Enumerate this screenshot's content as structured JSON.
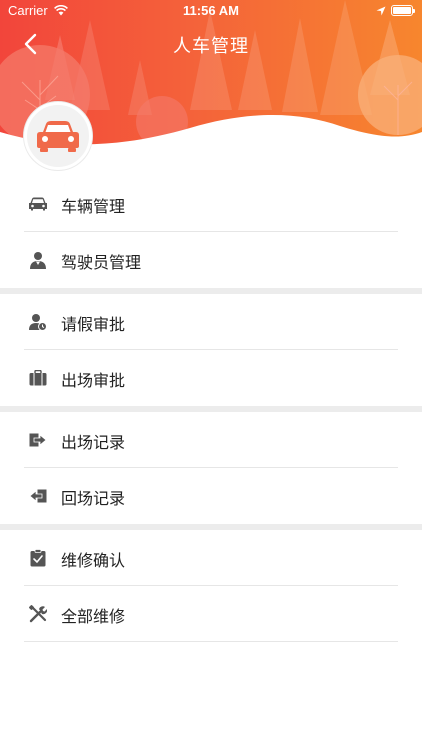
{
  "status_bar": {
    "carrier": "Carrier",
    "time": "11:56 AM"
  },
  "nav": {
    "title": "人车管理",
    "back_icon": "chevron-left-icon"
  },
  "colors": {
    "header_gradient_start": "#f2453b",
    "header_gradient_end": "#f7862e",
    "avatar_car": "#f06a4a",
    "icon_gray": "#555555",
    "group_divider": "#ececec"
  },
  "menu": {
    "groups": [
      {
        "items": [
          {
            "label": "车辆管理",
            "icon": "car-icon"
          },
          {
            "label": "驾驶员管理",
            "icon": "driver-icon"
          }
        ]
      },
      {
        "items": [
          {
            "label": "请假审批",
            "icon": "leave-approval-icon"
          },
          {
            "label": "出场审批",
            "icon": "briefcase-icon"
          }
        ]
      },
      {
        "items": [
          {
            "label": "出场记录",
            "icon": "exit-icon"
          },
          {
            "label": "回场记录",
            "icon": "return-icon"
          }
        ]
      },
      {
        "items": [
          {
            "label": "维修确认",
            "icon": "clipboard-check-icon"
          },
          {
            "label": "全部维修",
            "icon": "tools-icon"
          }
        ]
      }
    ]
  }
}
